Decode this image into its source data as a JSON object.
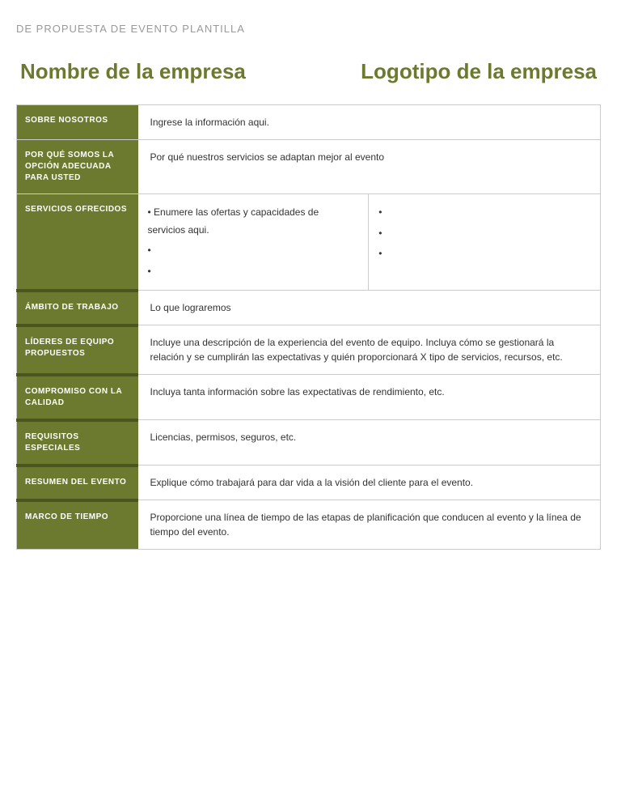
{
  "page": {
    "title": "DE PROPUESTA DE EVENTO PLANTILLA",
    "company_name": "Nombre de la empresa",
    "company_logo": "Logotipo de la empresa"
  },
  "table": {
    "rows": [
      {
        "id": "sobre_nosotros",
        "label": "SOBRE NOSOTROS",
        "content": "Ingrese la información aqui."
      },
      {
        "id": "por_que",
        "label": "POR QUÉ SOMOS LA OPCIÓN ADECUADA PARA USTED",
        "content": "Por qué nuestros servicios se adaptan mejor al evento"
      },
      {
        "id": "servicios",
        "label": "SERVICIOS OFRECIDOS",
        "col1_lines": [
          "• Enumere las ofertas y capacidades de servicios aqui.",
          "•",
          "•"
        ],
        "col2_lines": [
          "•",
          "•",
          "•"
        ]
      },
      {
        "id": "ambito",
        "label": "ÁMBITO DE TRABAJO",
        "content": "Lo que lograremos"
      },
      {
        "id": "lideres",
        "label": "LÍDERES DE EQUIPO PROPUESTOS",
        "content": "Incluye una descripción de la experiencia del evento de equipo. Incluya cómo se gestionará la relación y se cumplirán las expectativas y quién proporcionará X tipo de servicios, recursos, etc."
      },
      {
        "id": "compromiso",
        "label": "COMPROMISO CON LA CALIDAD",
        "content": "Incluya tanta información sobre las expectativas de rendimiento, etc."
      },
      {
        "id": "requisitos",
        "label": "REQUISITOS ESPECIALES",
        "content": "Licencias, permisos, seguros, etc."
      },
      {
        "id": "resumen",
        "label": "RESUMEN DEL EVENTO",
        "content": "Explique cómo trabajará para dar vida a la visión del cliente para el evento."
      },
      {
        "id": "marco",
        "label": "MARCO DE TIEMPO",
        "content": "Proporcione una línea de tiempo de las etapas de planificación que conducen al evento y la línea de tiempo del evento."
      }
    ]
  }
}
